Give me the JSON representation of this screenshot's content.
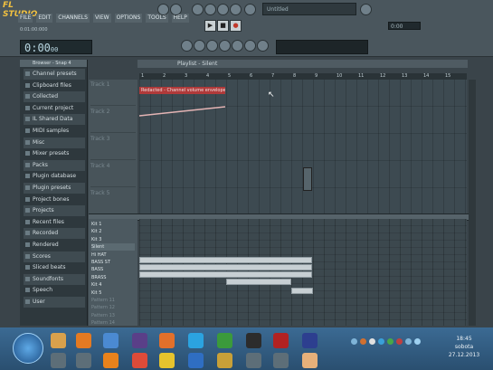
{
  "app": {
    "logo": "FL STUDIO"
  },
  "menu": [
    "FILE",
    "EDIT",
    "CHANNELS",
    "VIEW",
    "OPTIONS",
    "TOOLS",
    "HELP"
  ],
  "hint_text": "0:01:00:000",
  "lcd": {
    "time": "0:00",
    "sub": "00"
  },
  "transport": {
    "play": "▶",
    "stop": "■",
    "record": "●"
  },
  "song_box": "Untitled",
  "tempo_box": "0:00",
  "browser": {
    "header": "Browser - Snap 4",
    "items": [
      "Channel presets",
      "Clipboard files",
      "Collected",
      "Current project",
      "IL Shared Data",
      "MIDI samples",
      "Misc",
      "Mixer presets",
      "Packs",
      "Plugin database",
      "Plugin presets",
      "Project bones",
      "Projects",
      "Recent files",
      "Recorded",
      "Rendered",
      "Scores",
      "Sliced beats",
      "Soundfonts",
      "Speech",
      "User"
    ]
  },
  "playlist": {
    "title": "Playlist - Silent",
    "tracks": [
      "Track 1",
      "Track 2",
      "Track 3",
      "Track 4",
      "Track 5"
    ],
    "clip_label": "Redacted - Channel volume envelope",
    "ruler": [
      "1",
      "2",
      "3",
      "4",
      "5",
      "6",
      "7",
      "8",
      "9",
      "10",
      "11",
      "12",
      "13",
      "14",
      "15"
    ]
  },
  "pianoroll": {
    "labels": [
      "Kit 1",
      "Kit 2",
      "Kit 3",
      "Silent",
      "Hi HAT",
      "BASS ST",
      "BASS",
      "BRASS",
      "Kit 4",
      "Kit 5",
      "Pattern 11",
      "Pattern 12",
      "Pattern 13",
      "Pattern 14"
    ],
    "selected_index": 3,
    "dim_from": 10
  },
  "taskbar": {
    "time": "18:45",
    "day": "sobota",
    "date": "27.12.2013"
  },
  "colors": {
    "clip": "#b03a3a",
    "taskbar": "#2a4f70",
    "note": "#c7cfd3"
  }
}
